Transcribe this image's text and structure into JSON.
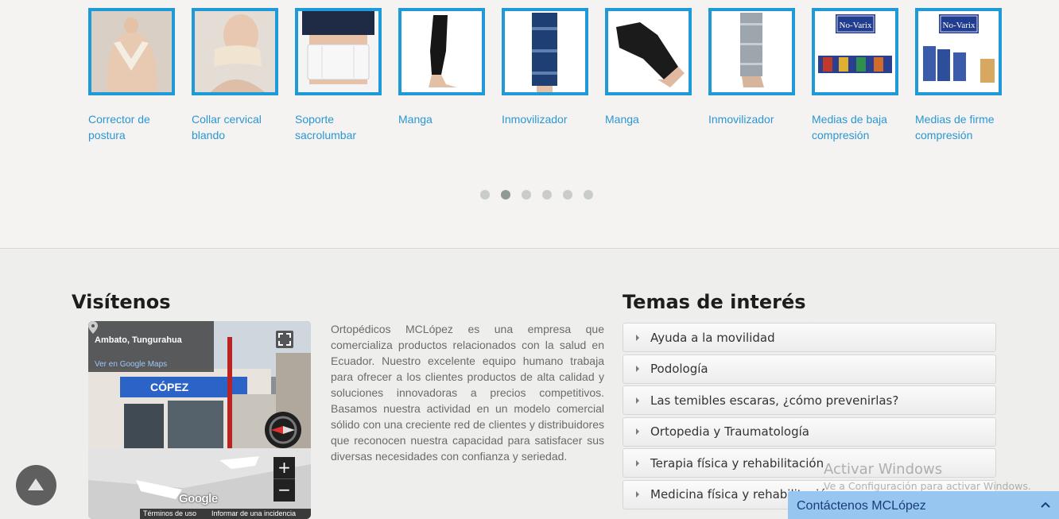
{
  "products": [
    {
      "name": "Corrector de postura",
      "icon": "posture-corrector-image"
    },
    {
      "name": "Collar cervical blando",
      "icon": "cervical-collar-image"
    },
    {
      "name": "Soporte sacrolumbar",
      "icon": "lumbar-support-image"
    },
    {
      "name": "Manga",
      "icon": "leg-sleeve-image"
    },
    {
      "name": "Inmovilizador",
      "icon": "knee-immobilizer-image"
    },
    {
      "name": "Manga",
      "icon": "knee-sleeve-image"
    },
    {
      "name": "Inmovilizador",
      "icon": "leg-immobilizer-image"
    },
    {
      "name": "Medias de baja compresión",
      "icon": "compression-stockings-image",
      "logo": "No-Varix"
    },
    {
      "name": "Medias de firme compresión",
      "icon": "compression-stockings-image",
      "logo": "No-Varix"
    }
  ],
  "carousel": {
    "dot_count": 6,
    "active_dot": 2
  },
  "visit": {
    "title": "Visítenos",
    "map": {
      "place": "Ambato, Tungurahua",
      "link": "Ver en Google Maps",
      "brand": "Google",
      "terms": "Términos de uso",
      "report": "Informar de una incidencia",
      "storefront_text": "CÓPEZ"
    },
    "about": "Ortopédicos MCLópez es una empresa que comercializa productos relacionados con la salud en Ecuador. Nuestro excelente equipo humano trabaja para ofrecer a los clientes productos de alta calidad y soluciones innovadoras a precios competitivos. Basamos nuestra actividad en un modelo comercial sólido con una creciente red de clientes y distribuidores que reconocen nuestra capacidad para satisfacer sus diversas necesidades con confianza y seriedad."
  },
  "topics": {
    "title": "Temas de interés",
    "items": [
      "Ayuda a la movilidad",
      "Podología",
      "Las temibles escaras, ¿cómo prevenirlas?",
      "Ortopedia y Traumatología",
      "Terapia física y rehabilitación",
      "Medicina física y rehabilitación"
    ]
  },
  "watermark": {
    "line1": "Activar Windows",
    "line2": "Ve a Configuración para activar Windows."
  },
  "contact": {
    "label": "Contáctenos MCLópez"
  },
  "colors": {
    "accent": "#1e9ad9",
    "link": "#2a97d3",
    "contact_bar": "#97c6f1"
  }
}
